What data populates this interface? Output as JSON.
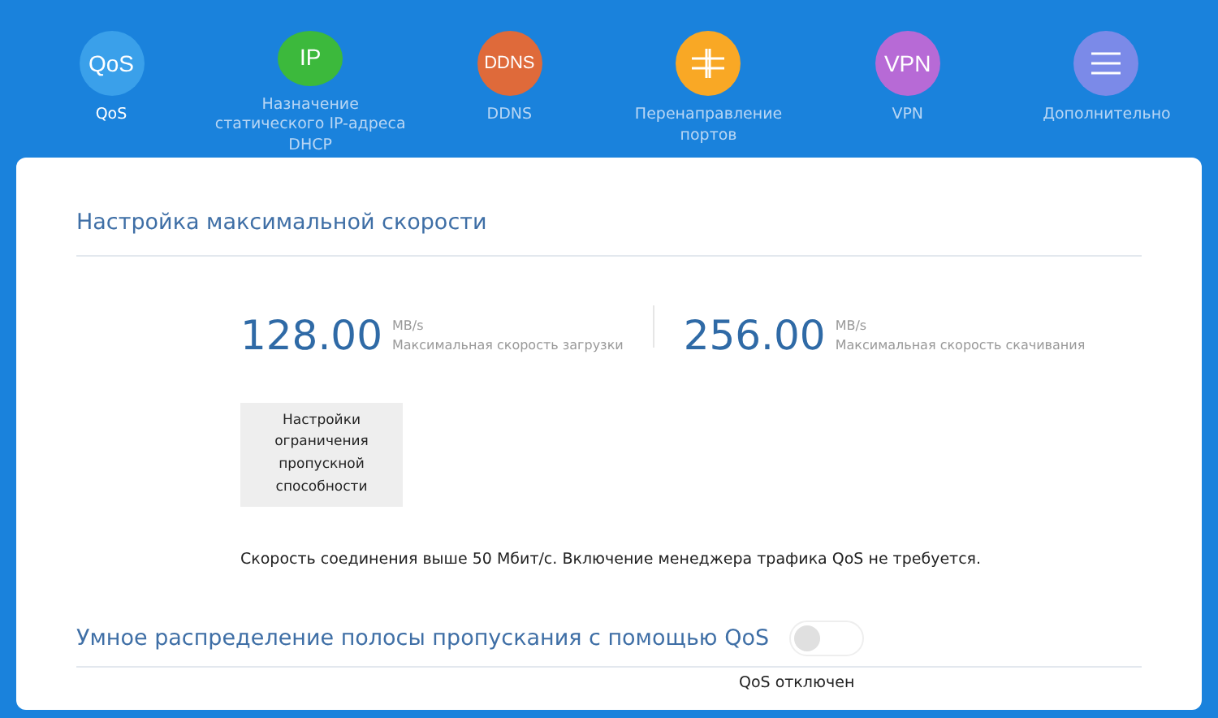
{
  "nav": [
    {
      "kind": "text",
      "icon_text": "QoS",
      "color": "#3aa0ea",
      "label": "QoS",
      "selected": true
    },
    {
      "kind": "text",
      "icon_text": "IP",
      "color": "#3cb93c",
      "label": "Назначение статического IP-адреса DHCP",
      "selected": false
    },
    {
      "kind": "text",
      "icon_text": "DDNS",
      "color": "#df6a3a",
      "label": "DDNS",
      "selected": false
    },
    {
      "kind": "ports",
      "color": "#f9a825",
      "label": "Перенаправление портов",
      "selected": false
    },
    {
      "kind": "text",
      "icon_text": "VPN",
      "color": "#b76ad6",
      "label": "VPN",
      "selected": false
    },
    {
      "kind": "menu",
      "color": "#7b8ae8",
      "label": "Дополнительно",
      "selected": false
    }
  ],
  "speed_section": {
    "title": "Настройка максимальной скорости",
    "stats": [
      {
        "value": "128.00",
        "unit": "MB/s",
        "label": "Максимальная скорость загрузки"
      },
      {
        "value": "256.00",
        "unit": "MB/s",
        "label": "Максимальная скорость скачивания"
      }
    ],
    "button": "Настройки ограничения пропускной способности",
    "note": "Скорость соединения выше 50 Мбит/с. Включение менеджера трафика QoS не требуется."
  },
  "qos_section": {
    "title": "Умное распределение полосы пропускания с помощью QoS",
    "on": false,
    "status": "QoS отключен"
  }
}
